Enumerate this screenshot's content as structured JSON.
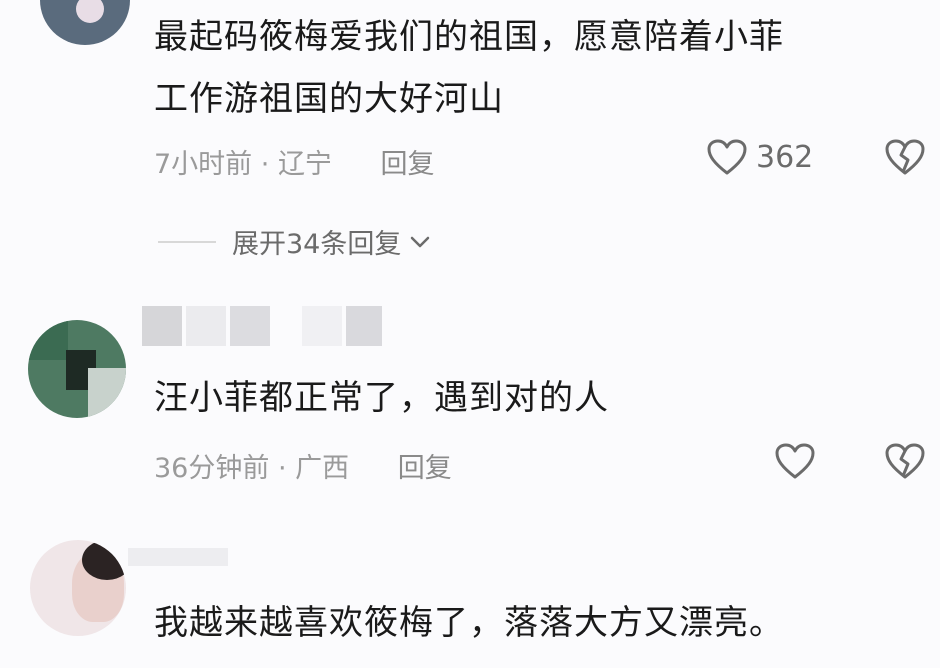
{
  "comments": [
    {
      "text_lines": [
        "最起码筱梅爱我们的祖国，愿意陪着小菲",
        "工作游祖国的大好河山"
      ],
      "time": "7小时前",
      "location": "辽宁",
      "reply_label": "回复",
      "like_count": "362",
      "expand_label": "展开34条回复"
    },
    {
      "text_lines": [
        "汪小菲都正常了，遇到对的人"
      ],
      "time": "36分钟前",
      "location": "广西",
      "reply_label": "回复",
      "like_count": ""
    },
    {
      "text_lines": [
        "我越来越喜欢筱梅了，落落大方又漂亮。"
      ]
    }
  ],
  "separator": " · ",
  "icons": {
    "like": "heart-outline-icon",
    "dislike": "broken-heart-icon",
    "expand": "chevron-down-icon"
  },
  "colors": {
    "background": "#fbfbfd",
    "text": "#1a1a1a",
    "meta": "#9a9a9a",
    "icon": "#6b6b6b"
  }
}
